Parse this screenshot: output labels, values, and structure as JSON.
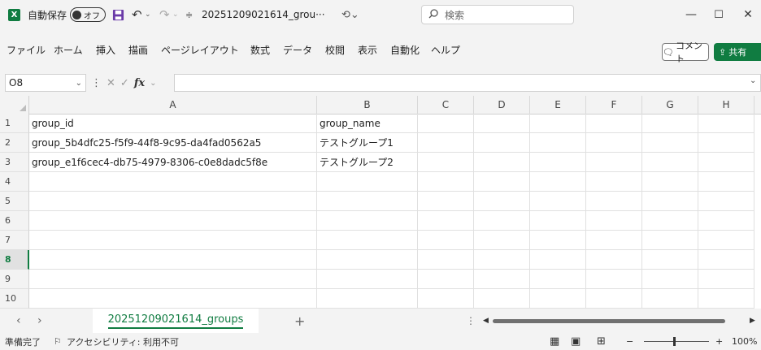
{
  "titlebar": {
    "autosave_label": "自動保存",
    "autosave_state": "オフ",
    "filename": "20251209021614_grou···",
    "search_placeholder": "検索",
    "minimize": "—",
    "maximize": "☐",
    "close": "✕"
  },
  "ribbon": {
    "tabs": [
      "ファイル",
      "ホーム",
      "挿入",
      "描画",
      "ページレイアウト",
      "数式",
      "データ",
      "校閲",
      "表示",
      "自動化",
      "ヘルプ"
    ],
    "comment_label": "コメント",
    "share_label": "共有"
  },
  "formula_bar": {
    "name_box": "O8",
    "formula": ""
  },
  "grid": {
    "columns": [
      "A",
      "B",
      "C",
      "D",
      "E",
      "F",
      "G",
      "H"
    ],
    "row_numbers": [
      "1",
      "2",
      "3",
      "4",
      "5",
      "6",
      "7",
      "8",
      "9",
      "10"
    ],
    "cells": [
      [
        "group_id",
        "group_name"
      ],
      [
        "group_5b4dfc25-f5f9-44f8-9c95-da4fad0562a5",
        "テストグループ1"
      ],
      [
        "group_e1f6cec4-db75-4979-8306-c0e8dadc5f8e",
        "テストグループ2"
      ]
    ],
    "active_row": "8"
  },
  "sheets": {
    "active_tab": "20251209021614_groups",
    "add_label": "+"
  },
  "status": {
    "ready": "準備完了",
    "accessibility": "アクセシビリティ: 利用不可",
    "zoom": "100%",
    "zoom_minus": "−",
    "zoom_plus": "+"
  },
  "colors": {
    "accent": "#107c41",
    "chrome": "#f3f3f3"
  }
}
